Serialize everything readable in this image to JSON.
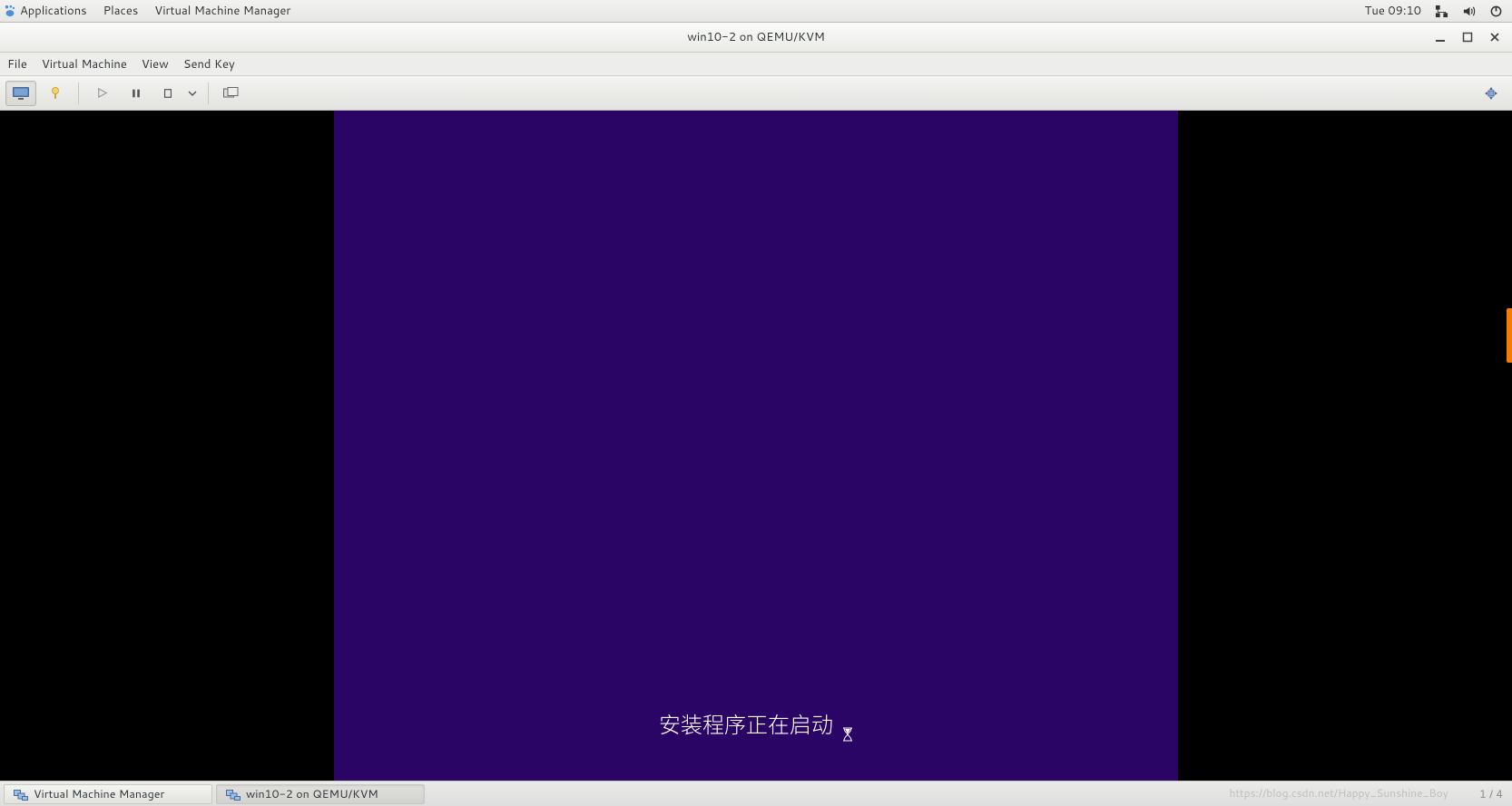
{
  "gnome": {
    "menus": {
      "applications": "Applications",
      "places": "Places",
      "focused_app": "Virtual Machine Manager"
    },
    "clock": "Tue 09:10"
  },
  "window": {
    "title": "win10-2 on QEMU/KVM",
    "menubar": {
      "file": "File",
      "virtual_machine": "Virtual Machine",
      "view": "View",
      "send_key": "Send Key"
    }
  },
  "guest": {
    "message": "安装程序正在启动"
  },
  "taskbar": {
    "items": [
      {
        "label": "Virtual Machine Manager"
      },
      {
        "label": "win10-2 on QEMU/KVM"
      }
    ],
    "pager": "1 / 4"
  },
  "watermark": "https://blog.csdn.net/Happy_Sunshine_Boy"
}
